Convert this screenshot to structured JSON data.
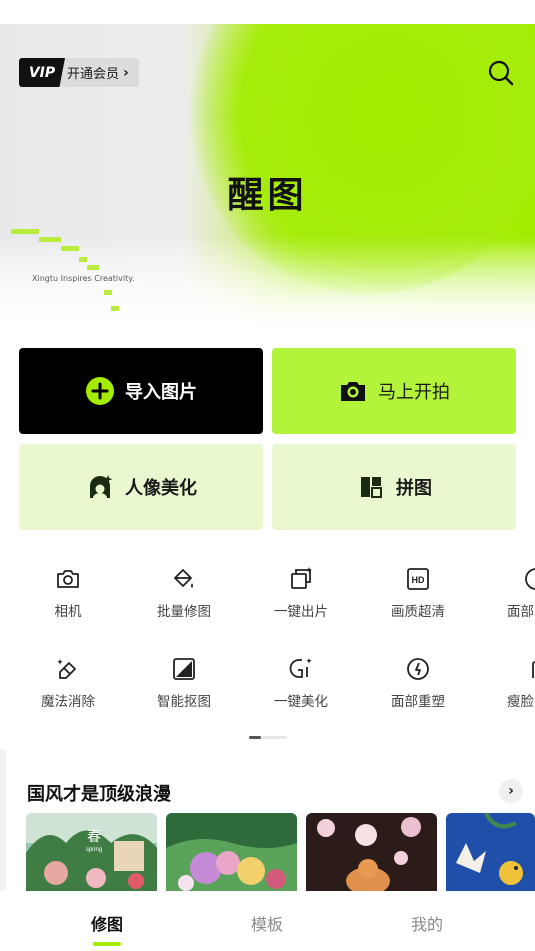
{
  "header": {
    "vip_badge": "VIP",
    "vip_cta": "开通会员",
    "app_title": "醒图",
    "slogan": "Xingtu Inspires Creativity."
  },
  "actions": {
    "import": "导入图片",
    "shoot": "马上开拍",
    "portrait": "人像美化",
    "collage": "拼图"
  },
  "tools": {
    "row1": [
      "相机",
      "批量修图",
      "一键出片",
      "画质超清",
      "面部"
    ],
    "row2": [
      "魔法消除",
      "智能抠图",
      "一键美化",
      "面部重塑",
      "瘦脸"
    ]
  },
  "section": {
    "title": "国风才是顶级浪漫",
    "thumb1_text": "春",
    "thumb1_sub": "spring"
  },
  "tabbar": {
    "tabs": [
      "修图",
      "模板",
      "我的"
    ],
    "active_index": 0
  },
  "colors": {
    "accent": "#a3ec00",
    "accent_light": "#eaf8d0",
    "dark": "#000000"
  }
}
